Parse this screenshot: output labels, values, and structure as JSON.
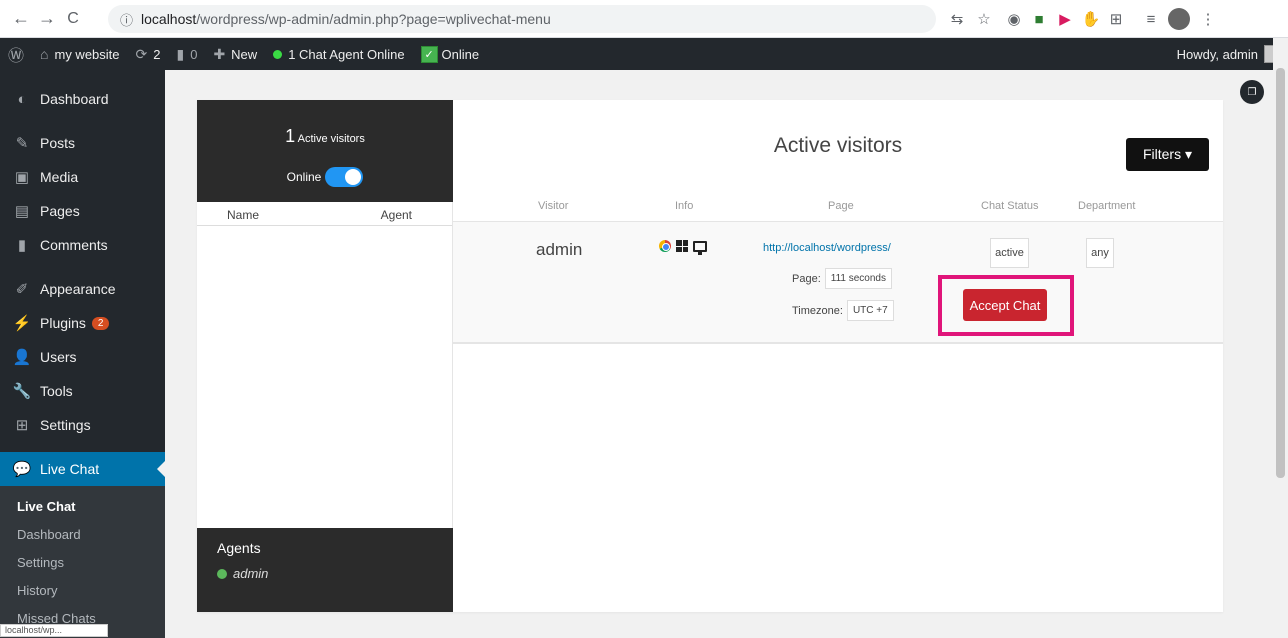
{
  "browser": {
    "back": "←",
    "forward": "→",
    "reload": "C",
    "info_icon": "ⓘ",
    "url_host": "localhost",
    "url_path": "/wordpress/wp-admin/admin.php?page=wplivechat-menu"
  },
  "adminbar": {
    "wp_logo": "Ⓦ",
    "site_name": "my website",
    "updates_count": "2",
    "comments_count": "0",
    "new_label": "New",
    "agents_online": "1 Chat Agent Online",
    "online_label": "Online",
    "howdy": "Howdy, admin"
  },
  "sidebar": {
    "items": [
      {
        "icon": "dashboard-icon",
        "label": "Dashboard"
      },
      {
        "icon": "pin-icon",
        "label": "Posts"
      },
      {
        "icon": "media-icon",
        "label": "Media"
      },
      {
        "icon": "pages-icon",
        "label": "Pages"
      },
      {
        "icon": "comments-icon",
        "label": "Comments"
      },
      {
        "icon": "appearance-icon",
        "label": "Appearance"
      },
      {
        "icon": "plugins-icon",
        "label": "Plugins",
        "badge": "2"
      },
      {
        "icon": "users-icon",
        "label": "Users"
      },
      {
        "icon": "tools-icon",
        "label": "Tools"
      },
      {
        "icon": "settings-icon",
        "label": "Settings"
      },
      {
        "icon": "chat-icon",
        "label": "Live Chat"
      }
    ],
    "submenu": [
      "Live Chat",
      "Dashboard",
      "Settings",
      "History",
      "Missed Chats"
    ]
  },
  "left_panel": {
    "count": "1",
    "count_label": "Active visitors",
    "online_label": "Online",
    "col_name": "Name",
    "col_agent": "Agent",
    "agents_title": "Agents",
    "agent_name": "admin"
  },
  "main": {
    "title": "Active visitors",
    "filters_label": "Filters ▾",
    "columns": [
      "Visitor",
      "Info",
      "Page",
      "Chat Status",
      "Department"
    ],
    "row": {
      "visitor": "admin",
      "page_url": "http://localhost/wordpress/",
      "page_time_label": "Page:",
      "page_time": "111 seconds",
      "timezone_label": "Timezone:",
      "timezone": "UTC +7",
      "status": "active",
      "department": "any",
      "accept_label": "Accept Chat"
    }
  },
  "status_tip": "localhost/wp..."
}
